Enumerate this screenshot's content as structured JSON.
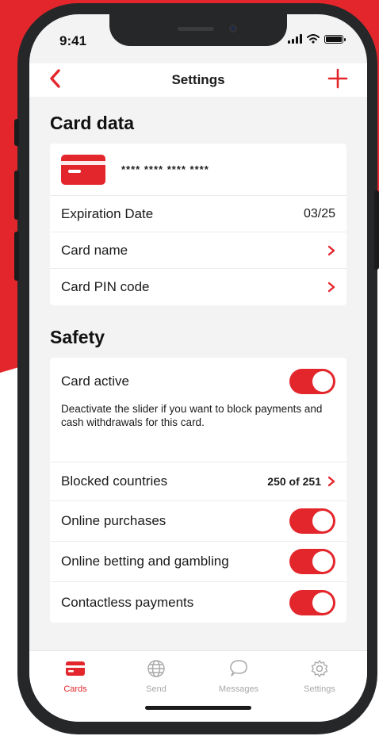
{
  "status": {
    "time": "9:41"
  },
  "header": {
    "title": "Settings"
  },
  "colors": {
    "accent": "#e3262c",
    "tab_inactive": "#a8a8a8"
  },
  "card_data": {
    "title": "Card data",
    "card_number": "**** **** **** ****",
    "expiration_label": "Expiration Date",
    "expiration_value": "03/25",
    "name_label": "Card name",
    "pin_label": "Card PIN code"
  },
  "safety": {
    "title": "Safety",
    "card_active_label": "Card active",
    "card_active_on": true,
    "card_active_desc": "Deactivate the slider if you want to block payments and cash withdrawals for this card.",
    "blocked_label": "Blocked countries",
    "blocked_value": "250 of 251",
    "online_purchases_label": "Online purchases",
    "online_purchases_on": true,
    "betting_label": "Online betting and gambling",
    "betting_on": true,
    "contactless_label": "Contactless payments",
    "contactless_on": true
  },
  "tabs": [
    {
      "label": "Cards",
      "icon": "card-icon",
      "active": true
    },
    {
      "label": "Send",
      "icon": "globe-icon",
      "active": false
    },
    {
      "label": "Messages",
      "icon": "chat-icon",
      "active": false
    },
    {
      "label": "Settings",
      "icon": "gear-icon",
      "active": false
    }
  ]
}
